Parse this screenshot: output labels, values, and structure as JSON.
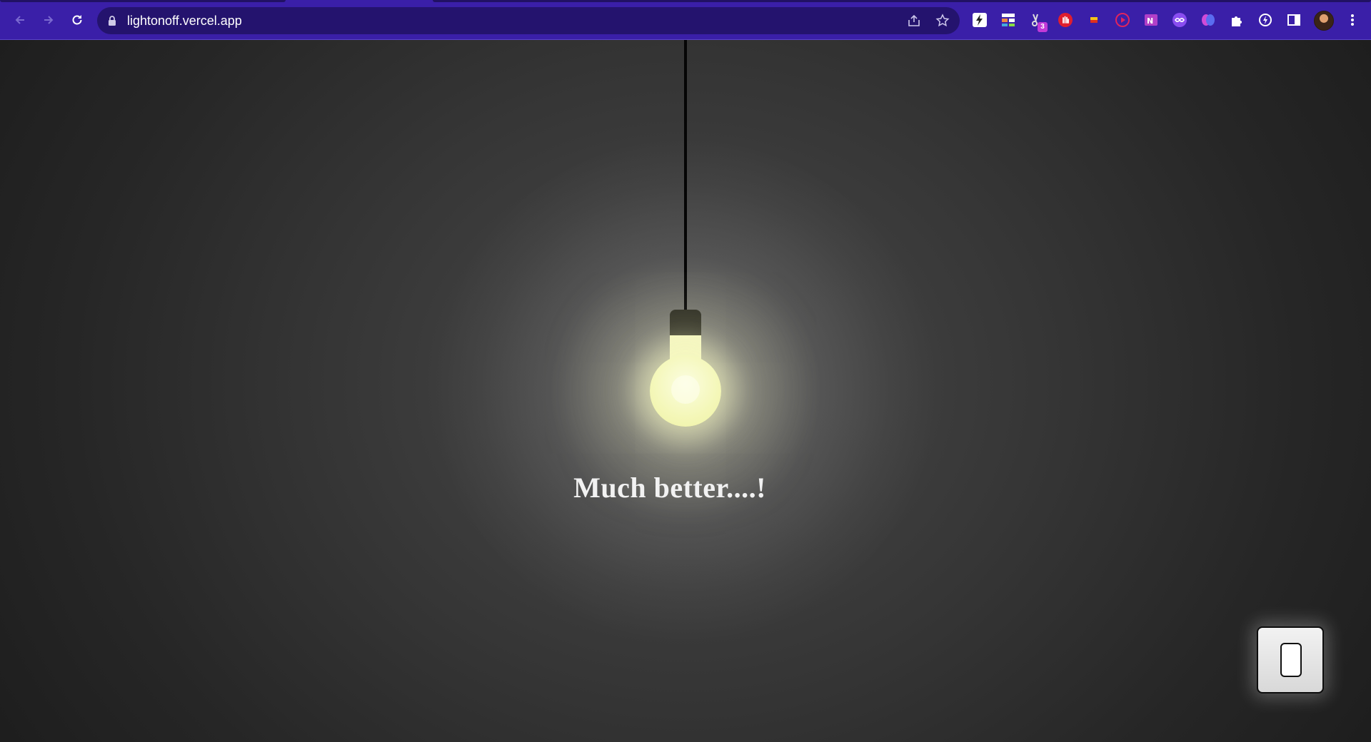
{
  "browser": {
    "url": "lightonoff.vercel.app",
    "colors": {
      "frame": "#3a1fa8",
      "omnibox": "#24136e"
    },
    "nav": {
      "back_icon": "arrow-left-icon",
      "forward_icon": "arrow-right-icon",
      "reload_icon": "reload-icon"
    },
    "omnibox_icons": [
      "lock-icon",
      "share-icon",
      "star-icon"
    ],
    "extension_icons": [
      "lightning-ext-icon",
      "grid-ext-icon",
      "scissors-ext-icon",
      "hand-ext-icon",
      "flag-ext-icon",
      "play-ext-icon",
      "onenote-ext-icon",
      "infinity-ext-icon",
      "brain-ext-icon",
      "puzzle-icon",
      "bolt-circle-icon",
      "sidepanel-icon"
    ],
    "badge_count": "3",
    "menu_icon": "kebab-menu-icon"
  },
  "page": {
    "message": "Much better....!",
    "light_state": "on",
    "colors": {
      "bulb": "#f4f7b8",
      "background": "#2b2b2b",
      "text": "#f2f2f2"
    }
  }
}
